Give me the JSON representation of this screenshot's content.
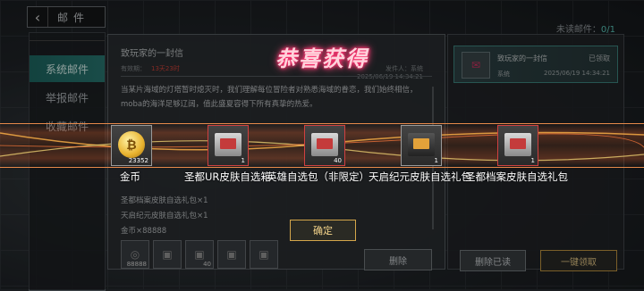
{
  "header": {
    "title": "邮件",
    "unread_label": "未读邮件：",
    "unread_count": "0/1"
  },
  "sidebar": {
    "items": [
      {
        "label": "系统邮件"
      },
      {
        "label": "举报邮件"
      },
      {
        "label": "收藏邮件"
      }
    ]
  },
  "letter": {
    "subject": "致玩家的一封信",
    "validity_label": "有效期：",
    "validity_value": "13天23时",
    "sender": "发件人：系统",
    "date": "2025/06/19 14:34:21",
    "body": "当某片海域的灯塔暂时熄灭时，我们理解每位冒险者对熟悉海域的眷恋，我们始终相信，moba的海洋足够辽阔，值此盛夏容得下所有真挚的热爱。",
    "attachments_text": [
      "圣都档案皮肤自选礼包×1",
      "天启纪元皮肤自选礼包×1",
      "金币×88888"
    ],
    "attachments": [
      {
        "icon": "gold-coin-icon",
        "count": "88888"
      },
      {
        "icon": "gift-box-icon",
        "count": ""
      },
      {
        "icon": "gift-box-icon",
        "count": "40"
      },
      {
        "icon": "gift-box-icon",
        "count": ""
      },
      {
        "icon": "gift-box-icon",
        "count": ""
      }
    ],
    "delete_label": "删除"
  },
  "mail_list": {
    "items": [
      {
        "title": "致玩家的一封信",
        "status": "已领取",
        "sender": "系统",
        "date": "2025/06/19 14:34:21"
      }
    ],
    "delete_read_label": "删除已读",
    "claim_all_label": "一键领取"
  },
  "reward_popup": {
    "title": "恭喜获得",
    "rewards": [
      {
        "name": "金币",
        "count": "23352",
        "icon": "gold-coin-icon"
      },
      {
        "name": "圣都UR皮肤自选箱",
        "count": "1",
        "icon": "gift-box-icon"
      },
      {
        "name": "英雄自选包（非限定）",
        "count": "40",
        "icon": "gift-box-icon"
      },
      {
        "name": "天启纪元皮肤自选礼包",
        "count": "1",
        "icon": "gift-box-icon"
      },
      {
        "name": "圣都档案皮肤自选礼包",
        "count": "1",
        "icon": "gift-box-icon"
      }
    ],
    "confirm_label": "确定"
  },
  "colors": {
    "accent_teal": "#2a7b75",
    "gold": "#d4a64a",
    "neon_pink": "#ff2d6d"
  }
}
